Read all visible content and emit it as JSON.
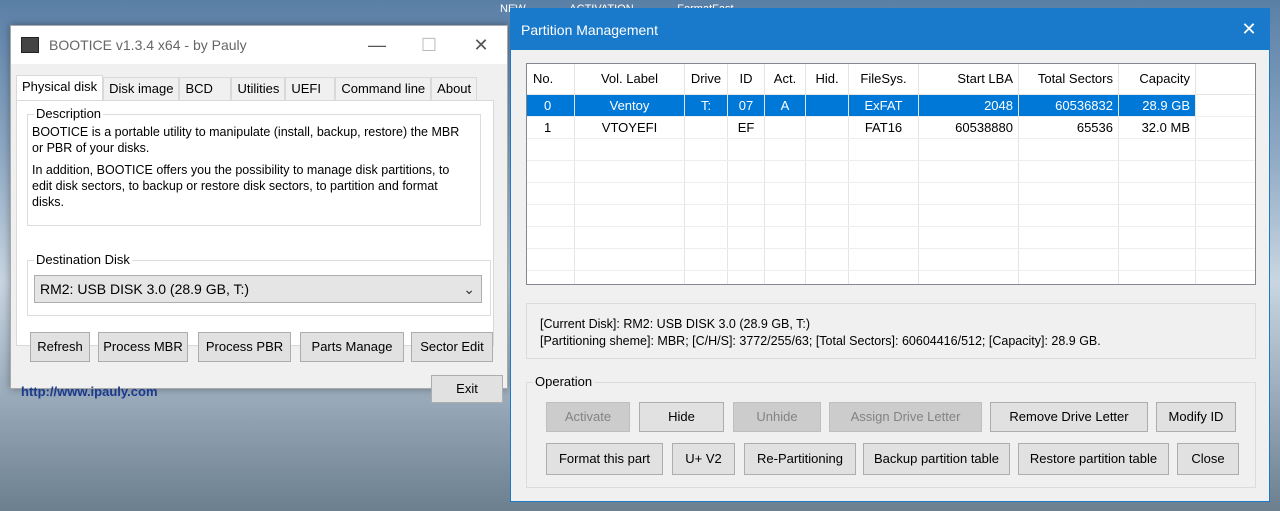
{
  "background": {
    "items": [
      "NEW",
      "ACTIVATION",
      "FormatFast"
    ]
  },
  "bootice": {
    "title": "BOOTICE v1.3.4 x64 - by Pauly",
    "tabs": [
      "Physical disk",
      "Disk image",
      "BCD",
      "Utilities",
      "UEFI",
      "Command line",
      "About"
    ],
    "description_legend": "Description",
    "description_p1": "BOOTICE is a portable utility to manipulate (install, backup, restore) the MBR or PBR of your disks.",
    "description_p2": "In addition, BOOTICE offers you the possibility to manage disk partitions, to edit disk sectors, to backup or restore disk sectors, to partition and format disks.",
    "dest_legend": "Destination Disk",
    "dest_value": "RM2:  USB DISK 3.0 (28.9 GB, T:)",
    "buttons": {
      "refresh": "Refresh",
      "process_mbr": "Process MBR",
      "process_pbr": "Process PBR",
      "parts_manage": "Parts Manage",
      "sector_edit": "Sector Edit"
    },
    "link": "http://www.ipauly.com",
    "exit": "Exit"
  },
  "pm": {
    "title": "Partition Management",
    "columns": [
      "No.",
      "Vol. Label",
      "Drive",
      "ID",
      "Act.",
      "Hid.",
      "FileSys.",
      "Start LBA",
      "Total Sectors",
      "Capacity"
    ],
    "rows": [
      {
        "no": "0",
        "vol": "Ventoy",
        "drive": "T:",
        "id": "07",
        "act": "A",
        "hid": "",
        "fs": "ExFAT",
        "lba": "2048",
        "ts": "60536832",
        "cap": "28.9 GB"
      },
      {
        "no": "1",
        "vol": "VTOYEFI",
        "drive": "",
        "id": "EF",
        "act": "",
        "hid": "",
        "fs": "FAT16",
        "lba": "60538880",
        "ts": "65536",
        "cap": "32.0 MB"
      }
    ],
    "info_line1": "[Current Disk]:    RM2:  USB DISK 3.0 (28.9 GB, T:)",
    "info_line2": "[Partitioning sheme]:      MBR;      [C/H/S]: 3772/255/63; [Total Sectors]: 60604416/512; [Capacity]: 28.9 GB.",
    "operation_legend": "Operation",
    "buttons": {
      "activate": "Activate",
      "hide": "Hide",
      "unhide": "Unhide",
      "assign": "Assign Drive Letter",
      "remove": "Remove Drive Letter",
      "modify_id": "Modify ID",
      "format": "Format this part",
      "uv2": "U+ V2",
      "repartition": "Re-Partitioning",
      "backup": "Backup partition table",
      "restore": "Restore partition table",
      "close": "Close"
    }
  }
}
